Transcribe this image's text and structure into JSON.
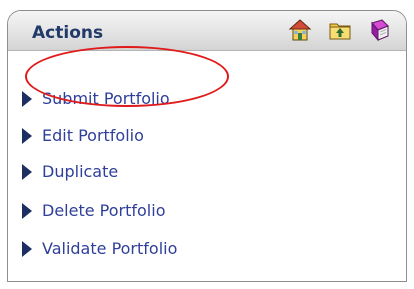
{
  "panel": {
    "title": "Actions"
  },
  "header_icons": [
    {
      "name": "home-icon"
    },
    {
      "name": "folder-up-icon"
    },
    {
      "name": "notebook-icon"
    }
  ],
  "actions": [
    {
      "label": "Submit Portfolio"
    },
    {
      "label": "Edit Portfolio"
    },
    {
      "label": "Duplicate"
    },
    {
      "label": "Delete Portfolio"
    },
    {
      "label": "Validate Portfolio"
    }
  ],
  "colors": {
    "title": "#223a6a",
    "link": "#2f3f9a",
    "bullet": "#1d2f62",
    "highlight": "#e01b1b",
    "border": "#8e8e8e"
  }
}
